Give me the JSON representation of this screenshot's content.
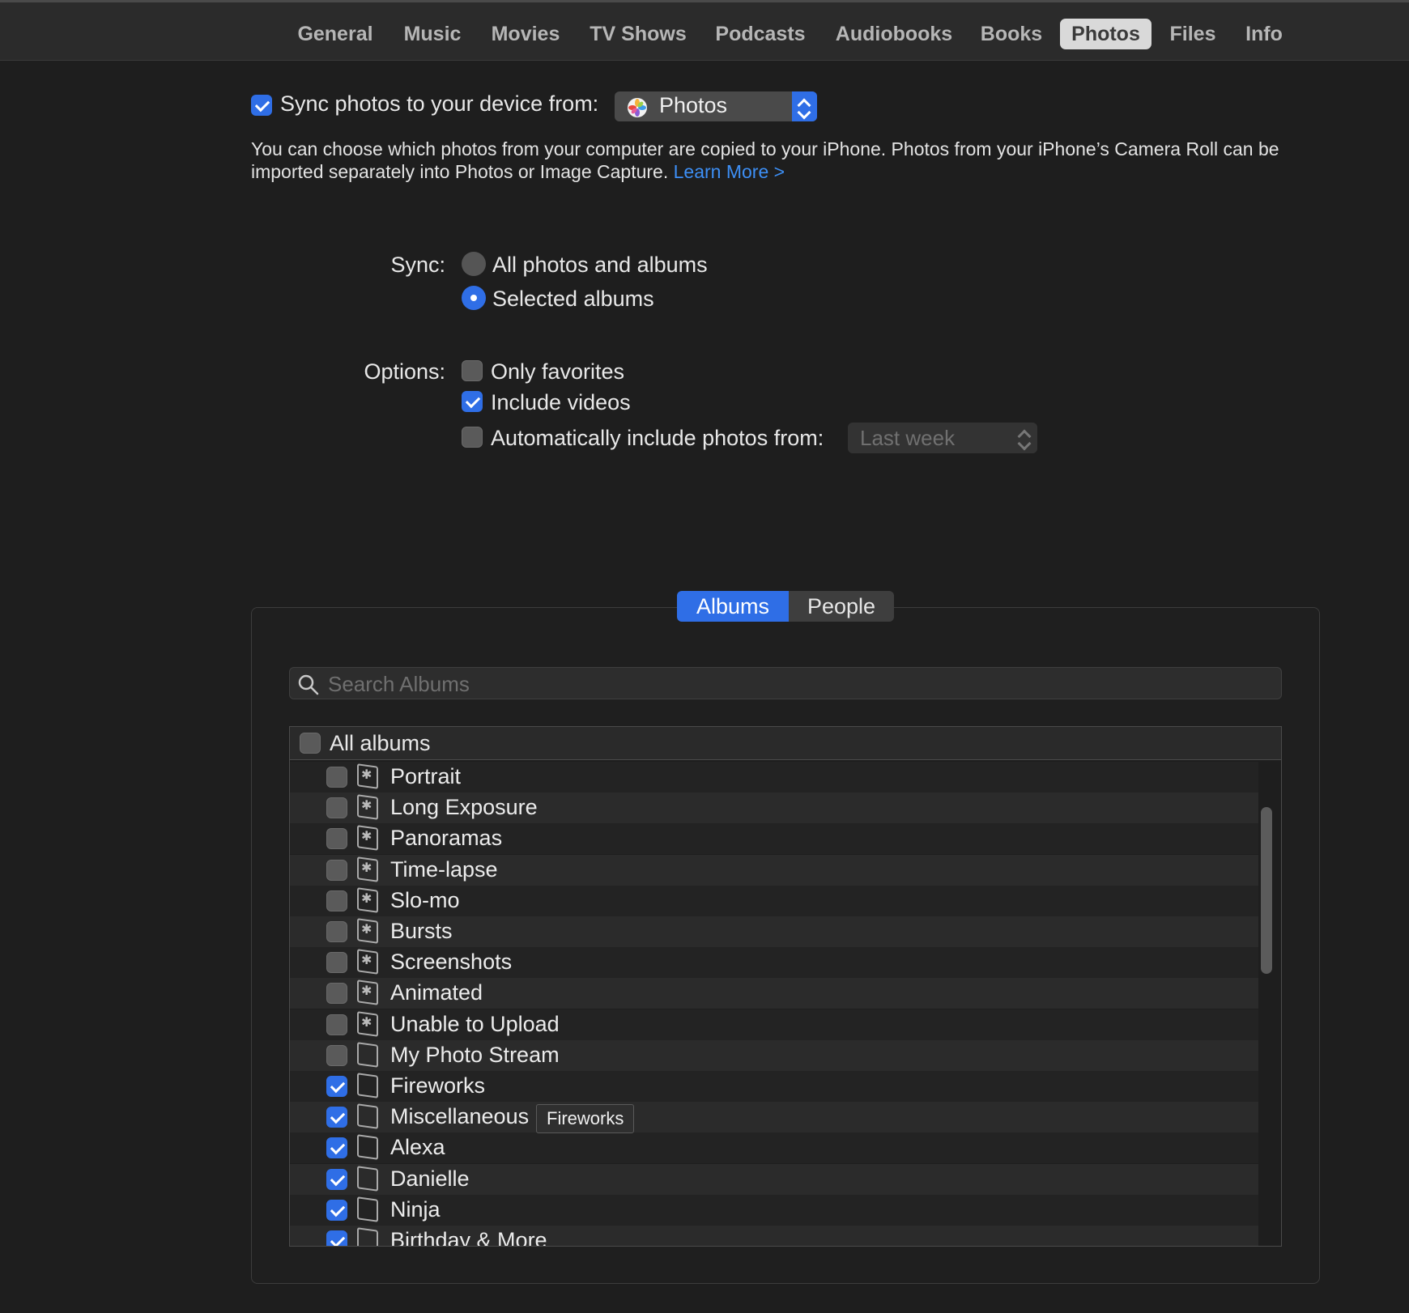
{
  "tabs": [
    {
      "label": "General",
      "active": false
    },
    {
      "label": "Music",
      "active": false
    },
    {
      "label": "Movies",
      "active": false
    },
    {
      "label": "TV Shows",
      "active": false
    },
    {
      "label": "Podcasts",
      "active": false
    },
    {
      "label": "Audiobooks",
      "active": false
    },
    {
      "label": "Books",
      "active": false
    },
    {
      "label": "Photos",
      "active": true
    },
    {
      "label": "Files",
      "active": false
    },
    {
      "label": "Info",
      "active": false
    }
  ],
  "sync_header": {
    "checked": true,
    "label": "Sync photos to your device from:",
    "source_value": "Photos",
    "source_icon": "photos-app-icon"
  },
  "description": {
    "text": "You can choose which photos from your computer are copied to your iPhone. Photos from your iPhone’s Camera Roll can be imported separately into Photos or Image Capture. ",
    "link": "Learn More >"
  },
  "sync_mode": {
    "label": "Sync:",
    "options": [
      {
        "label": "All photos and albums",
        "selected": false
      },
      {
        "label": "Selected albums",
        "selected": true
      }
    ]
  },
  "options": {
    "label": "Options:",
    "only_favorites": {
      "label": "Only favorites",
      "checked": false
    },
    "include_videos": {
      "label": "Include videos",
      "checked": true
    },
    "auto_include": {
      "label": "Automatically include photos from:",
      "checked": false,
      "range_value": "Last week"
    }
  },
  "segmented": {
    "albums": "Albums",
    "people": "People",
    "selected": "Albums"
  },
  "search": {
    "placeholder": "Search Albums",
    "value": ""
  },
  "all_albums": {
    "label": "All albums",
    "checked": false
  },
  "albums": [
    {
      "name": "Portrait",
      "checked": false,
      "smart": true
    },
    {
      "name": "Long Exposure",
      "checked": false,
      "smart": true
    },
    {
      "name": "Panoramas",
      "checked": false,
      "smart": true
    },
    {
      "name": "Time-lapse",
      "checked": false,
      "smart": true
    },
    {
      "name": "Slo-mo",
      "checked": false,
      "smart": true
    },
    {
      "name": "Bursts",
      "checked": false,
      "smart": true
    },
    {
      "name": "Screenshots",
      "checked": false,
      "smart": true
    },
    {
      "name": "Animated",
      "checked": false,
      "smart": true
    },
    {
      "name": "Unable to Upload",
      "checked": false,
      "smart": true
    },
    {
      "name": "My Photo Stream",
      "checked": false,
      "smart": false
    },
    {
      "name": "Fireworks",
      "checked": true,
      "smart": false
    },
    {
      "name": "Miscellaneous",
      "checked": true,
      "smart": false
    },
    {
      "name": "Alexa",
      "checked": true,
      "smart": false
    },
    {
      "name": "Danielle",
      "checked": true,
      "smart": false
    },
    {
      "name": "Ninja",
      "checked": true,
      "smart": false
    },
    {
      "name": "Birthday & More",
      "checked": true,
      "smart": false
    }
  ],
  "tooltip": "Fireworks",
  "colors": {
    "accent": "#2f6ee6",
    "link": "#3d8ff5",
    "background": "#1e1e1e"
  }
}
